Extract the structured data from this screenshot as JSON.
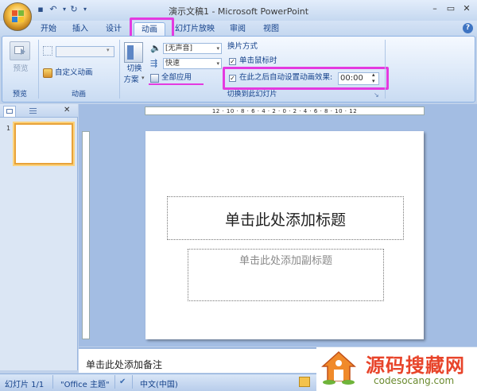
{
  "window": {
    "title": "演示文稿1 - Microsoft PowerPoint",
    "controls": [
      "–",
      "▭",
      "✕"
    ]
  },
  "tabs": [
    "开始",
    "插入",
    "设计",
    "动画",
    "幻灯片放映",
    "审阅",
    "视图"
  ],
  "active_tab": "动画",
  "ribbon": {
    "preview": {
      "button": "预览",
      "group": "预览"
    },
    "animation": {
      "dropdown_value": "",
      "custom_button": "自定义动画",
      "group": "动画"
    },
    "transition": {
      "scheme_button_line1": "切换",
      "scheme_button_line2": "方案",
      "sound_value": "[无声音]",
      "speed_value": "快速",
      "apply_all": "全部应用",
      "advance_header": "换片方式",
      "on_click": "单击鼠标时",
      "auto_after": "在此之后自动设置动画效果:",
      "auto_time": "00:00",
      "group": "切换到此幻灯片"
    }
  },
  "left_panel": {
    "slide_number": "1",
    "close": "✕"
  },
  "ruler": {
    "horizontal": "12 · 10 · 8 · 6 · 4 · 2 · 0 · 2 · 4 · 6 · 8 · 10 · 12"
  },
  "slide": {
    "title_placeholder": "单击此处添加标题",
    "subtitle_placeholder": "单击此处添加副标题"
  },
  "notes": {
    "placeholder": "单击此处添加备注"
  },
  "status": {
    "slide": "幻灯片 1/1",
    "theme": "\"Office 主题\"",
    "language": "中文(中国)"
  },
  "watermark": {
    "title": "源码搜藏网",
    "url": "codesocang.com"
  },
  "colors": {
    "highlight": "#e43ae0",
    "ribbon_text": "#15428b"
  }
}
